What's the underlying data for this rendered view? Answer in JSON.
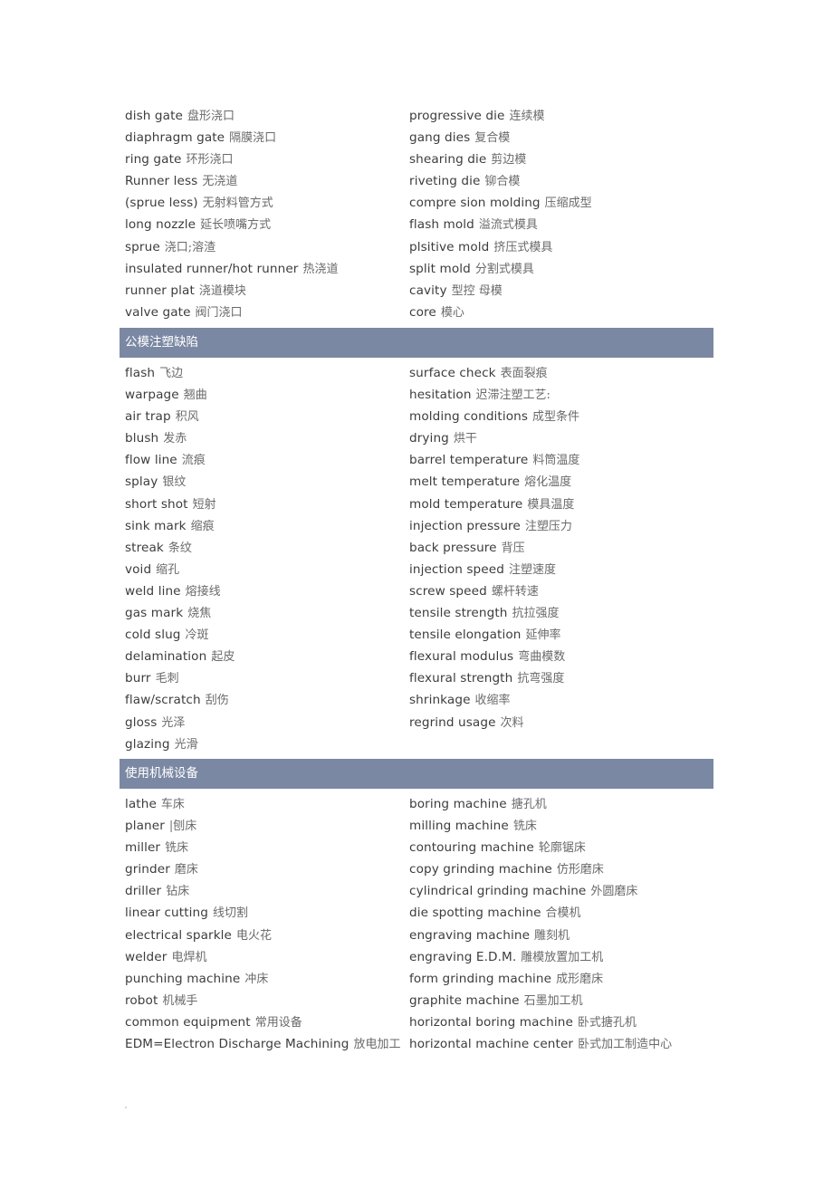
{
  "sections": [
    {
      "header": null,
      "left": [
        {
          "en": "dish gate",
          "zh": "盘形浇口"
        },
        {
          "en": "diaphragm gate",
          "zh": "隔膜浇口"
        },
        {
          "en": "ring gate",
          "zh": "环形浇口"
        },
        {
          "en": "Runner less",
          "zh": "无浇道"
        },
        {
          "en": "(sprue less)",
          "zh": "无射料管方式"
        },
        {
          "en": "long nozzle",
          "zh": "延长喷嘴方式"
        },
        {
          "en": "sprue",
          "zh": "浇口;溶渣"
        },
        {
          "en": "insulated runner/hot runner",
          "zh": "热浇道"
        },
        {
          "en": "runner plat",
          "zh": "浇道模块"
        },
        {
          "en": "valve gate",
          "zh": "阀门浇口"
        }
      ],
      "right": [
        {
          "en": "progressive die",
          "zh": "连续模"
        },
        {
          "en": "gang dies",
          "zh": "复合模"
        },
        {
          "en": "shearing die",
          "zh": "剪边模"
        },
        {
          "en": "riveting die",
          "zh": "铆合模"
        },
        {
          "en": "compre sion molding",
          "zh": "压缩成型"
        },
        {
          "en": "flash mold",
          "zh": "溢流式模具"
        },
        {
          "en": "plsitive mold",
          "zh": "挤压式模具"
        },
        {
          "en": "split mold",
          "zh": "分割式模具"
        },
        {
          "en": "cavity",
          "zh": "型控  母模"
        },
        {
          "en": "core",
          "zh": "模心"
        }
      ]
    },
    {
      "header": "公模注塑缺陷",
      "left": [
        {
          "en": "flash",
          "zh": "飞边"
        },
        {
          "en": "warpage",
          "zh": "翘曲"
        },
        {
          "en": "air trap",
          "zh": "积风"
        },
        {
          "en": "blush",
          "zh": "发赤"
        },
        {
          "en": "flow line",
          "zh": "流痕"
        },
        {
          "en": "splay",
          "zh": "银纹"
        },
        {
          "en": "short shot",
          "zh": "短射"
        },
        {
          "en": "sink mark",
          "zh": "缩痕"
        },
        {
          "en": "streak",
          "zh": "条纹"
        },
        {
          "en": "void",
          "zh": "缩孔"
        },
        {
          "en": "weld line",
          "zh": "熔接线"
        },
        {
          "en": "gas mark",
          "zh": "烧焦"
        },
        {
          "en": "cold slug",
          "zh": "冷斑"
        },
        {
          "en": "delamination",
          "zh": "起皮"
        },
        {
          "en": "burr",
          "zh": "毛刺"
        },
        {
          "en": "flaw/scratch",
          "zh": "刮伤"
        },
        {
          "en": "gloss",
          "zh": "光泽"
        },
        {
          "en": "glazing",
          "zh": "光滑"
        }
      ],
      "right": [
        {
          "en": "surface check",
          "zh": "表面裂痕"
        },
        {
          "en": "hesitation",
          "zh": "迟滞注塑工艺:"
        },
        {
          "en": "molding conditions",
          "zh": "成型条件"
        },
        {
          "en": "drying",
          "zh": "烘干"
        },
        {
          "en": "barrel temperature",
          "zh": "料筒温度"
        },
        {
          "en": "melt temperature",
          "zh": "熔化温度"
        },
        {
          "en": "mold temperature",
          "zh": "模具温度"
        },
        {
          "en": "injection pressure",
          "zh": "注塑压力"
        },
        {
          "en": "back pressure",
          "zh": "背压"
        },
        {
          "en": "injection speed",
          "zh": "注塑速度"
        },
        {
          "en": "screw speed",
          "zh": "螺杆转速"
        },
        {
          "en": "tensile strength",
          "zh": "抗拉强度"
        },
        {
          "en": "tensile elongation",
          "zh": "延伸率"
        },
        {
          "en": "flexural modulus",
          "zh": "弯曲模数"
        },
        {
          "en": "flexural strength",
          "zh": "抗弯强度"
        },
        {
          "en": "shrinkage",
          "zh": "收缩率"
        },
        {
          "en": "regrind usage",
          "zh": "次料"
        }
      ]
    },
    {
      "header": "使用机械设备",
      "left": [
        {
          "en": "lathe",
          "zh": "车床"
        },
        {
          "en": "planer",
          "zh": "|刨床"
        },
        {
          "en": "miller",
          "zh": "铣床"
        },
        {
          "en": "grinder",
          "zh": "磨床"
        },
        {
          "en": "driller",
          "zh": "钻床"
        },
        {
          "en": "linear cutting",
          "zh": "线切割"
        },
        {
          "en": "electrical sparkle",
          "zh": "电火花"
        },
        {
          "en": "welder",
          "zh": "电焊机"
        },
        {
          "en": "punching machine",
          "zh": "冲床"
        },
        {
          "en": "robot",
          "zh": "机械手"
        },
        {
          "en": "common equipment",
          "zh": "常用设备"
        },
        {
          "en": "EDM=Electron Discharge Machining",
          "zh": "放电加工"
        }
      ],
      "right": [
        {
          "en": "boring machine",
          "zh": "搪孔机"
        },
        {
          "en": "milling machine",
          "zh": "铣床"
        },
        {
          "en": "contouring machine",
          "zh": "轮廓锯床"
        },
        {
          "en": "copy grinding machine",
          "zh": "仿形磨床"
        },
        {
          "en": "cylindrical grinding machine",
          "zh": "外圆磨床"
        },
        {
          "en": "die spotting machine",
          "zh": "合模机"
        },
        {
          "en": "engraving machine",
          "zh": "雕刻机"
        },
        {
          "en": "engraving E.D.M.",
          "zh": "雕模放置加工机"
        },
        {
          "en": "form grinding machine",
          "zh": "成形磨床"
        },
        {
          "en": "graphite machine",
          "zh": "石墨加工机"
        },
        {
          "en": "horizontal boring machine",
          "zh": "卧式搪孔机"
        },
        {
          "en": "horizontal machine center",
          "zh": "卧式加工制造中心"
        }
      ]
    }
  ],
  "colors": {
    "header_bg": "#7b88a3",
    "header_text": "#ffffff",
    "term_text": "#3c3c3c",
    "translation_text": "#6a6a6a"
  }
}
